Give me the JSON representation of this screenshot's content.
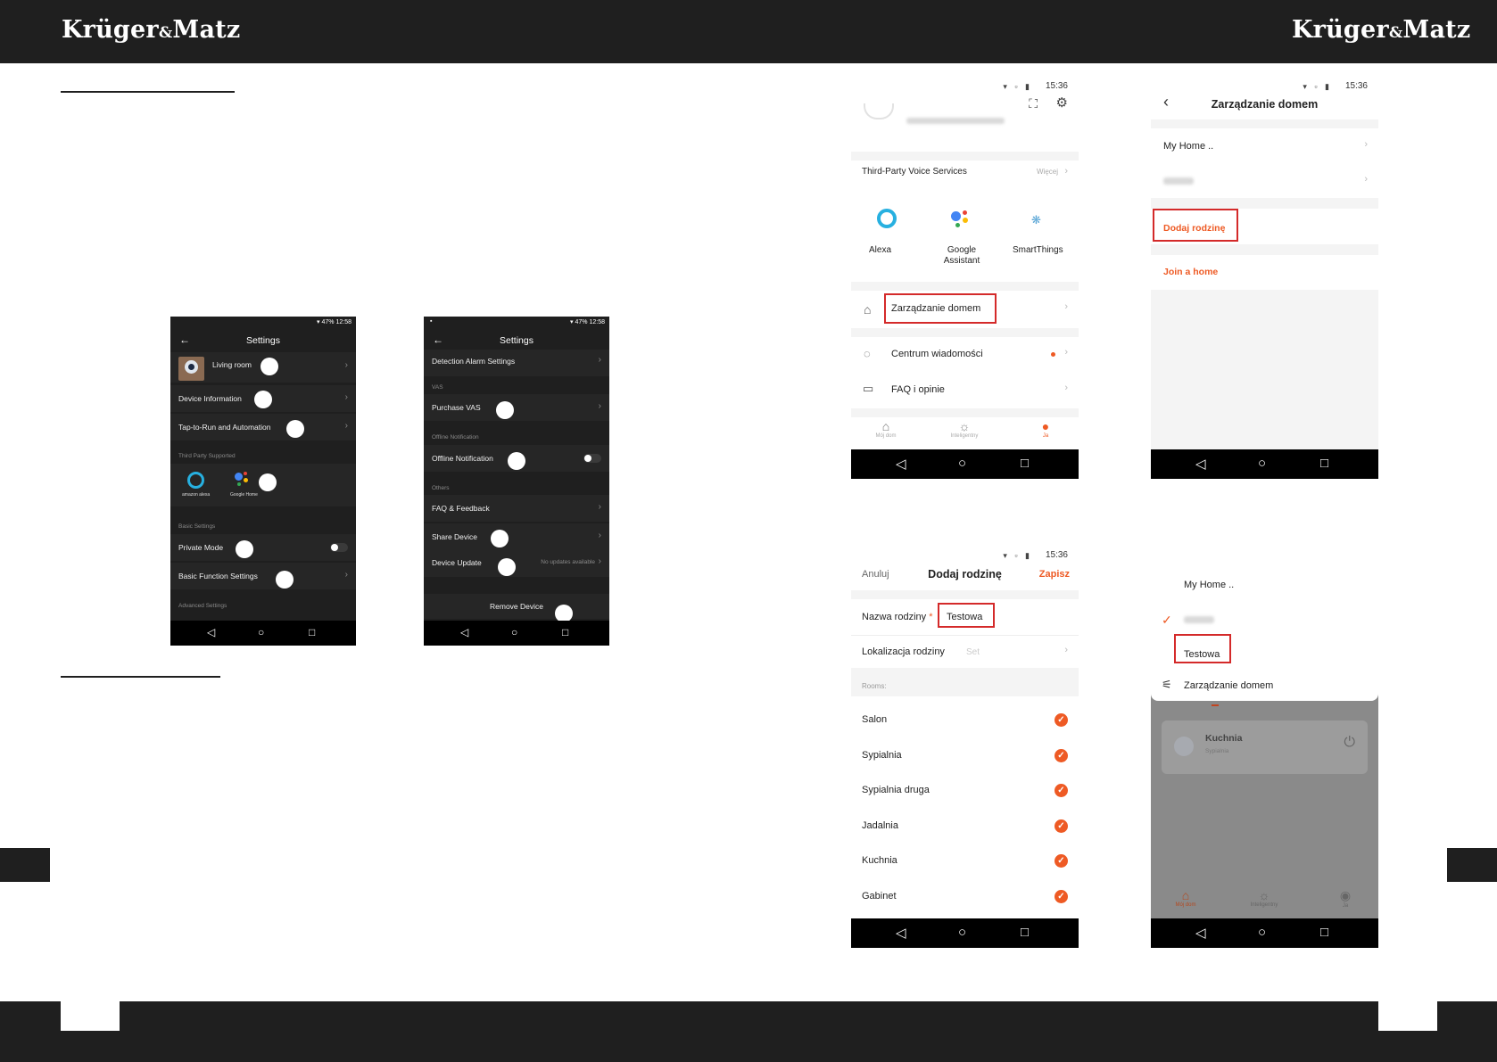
{
  "header": {
    "brand_left": "Krüger",
    "brand_amp": "&",
    "brand_right": "Matz"
  },
  "settings_screen_1": {
    "status_time": "12:58",
    "status_battery": "47%",
    "title": "Settings",
    "rows": [
      {
        "label": "Living room"
      },
      {
        "label": "Device Information"
      },
      {
        "label": "Tap-to-Run and Automation"
      }
    ],
    "section_third_party": "Third Party Supported",
    "alexa_caption": "amazon alexa",
    "google_caption": "Google Home",
    "section_basic": "Basic Settings",
    "private_mode": "Private Mode",
    "private_mode_on": false,
    "basic_function": "Basic Function Settings",
    "section_advanced": "Advanced Settings"
  },
  "settings_screen_2": {
    "status_time": "12:58",
    "status_battery": "47%",
    "title": "Settings",
    "detection": "Detection Alarm Settings",
    "section_vas": "VAS",
    "purchase_vas": "Purchase VAS",
    "section_offline": "Offline Notification",
    "offline_notification": "Offline Notification",
    "offline_notification_on": false,
    "section_others": "Others",
    "faq": "FAQ & Feedback",
    "share": "Share Device",
    "update": "Device Update",
    "update_status": "No updates available",
    "remove": "Remove Device"
  },
  "profile_screen": {
    "status_time": "15:36",
    "voice_services": "Third-Party Voice Services",
    "more": "Więcej",
    "alexa": "Alexa",
    "google_line1": "Google",
    "google_line2": "Assistant",
    "smartthings": "SmartThings",
    "home_management": "Zarządzanie domem",
    "messages": "Centrum wiadomości",
    "faq": "FAQ i opinie",
    "tabs": [
      "Mój dom",
      "Inteligentny",
      "Ja"
    ]
  },
  "home_management_screen": {
    "status_time": "15:36",
    "title": "Zarządzanie domem",
    "home_1": "My Home ..",
    "add_family": "Dodaj rodzinę",
    "join_home": "Join a home"
  },
  "add_family_screen": {
    "status_time": "15:36",
    "cancel": "Anuluj",
    "title": "Dodaj rodzinę",
    "save": "Zapisz",
    "family_name_label": "Nazwa rodziny",
    "required_mark": "*",
    "family_name_value": "Testowa",
    "location_label": "Lokalizacja rodziny",
    "location_value": "Set",
    "rooms_section": "Rooms:",
    "rooms": [
      "Salon",
      "Sypialnia",
      "Sypialnia druga",
      "Jadalnia",
      "Kuchnia",
      "Gabinet"
    ]
  },
  "home_switch_screen": {
    "home_1": "My Home ..",
    "new_home": "Testowa",
    "manage": "Zarządzanie domem",
    "card_title": "Kuchnia",
    "card_sub": "Sypialnia",
    "tabs": [
      "Mój dom",
      "Inteligentny",
      "Ja"
    ]
  },
  "icons": {
    "check": "✓",
    "chevron": "›",
    "back": "←",
    "back_thin": "‹",
    "nav_back": "◁",
    "nav_home": "○",
    "nav_recent": "□"
  }
}
